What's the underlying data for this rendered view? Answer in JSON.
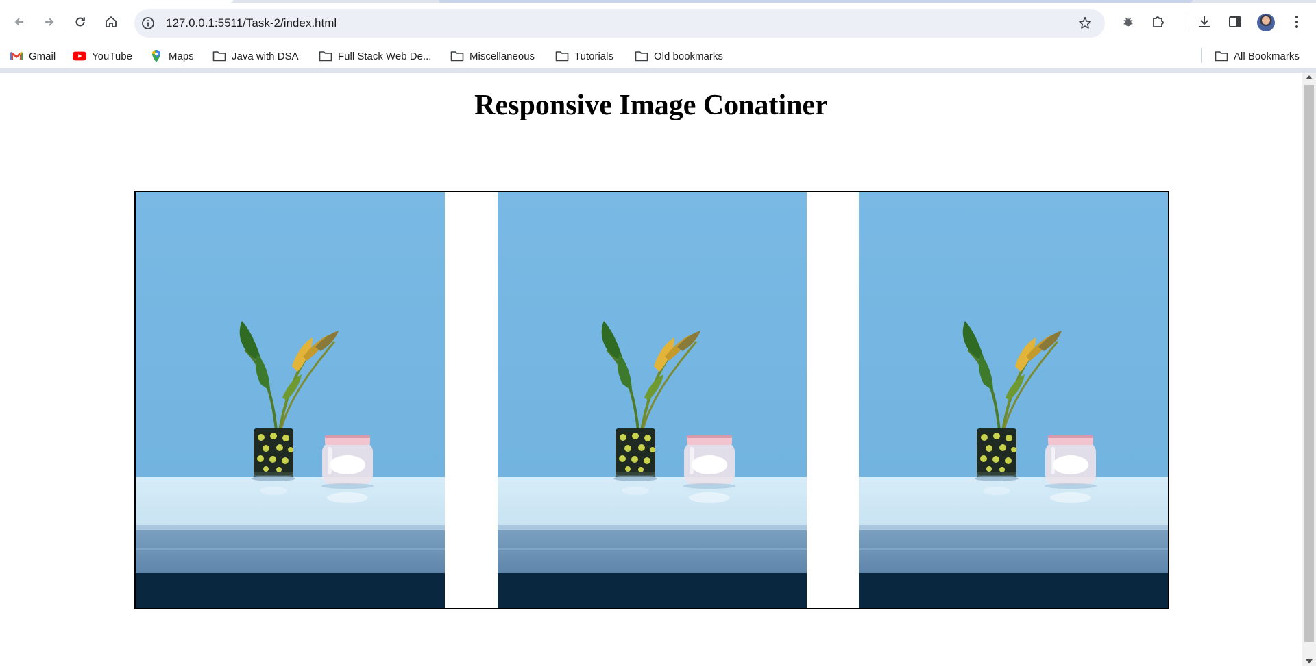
{
  "browser": {
    "url": "127.0.0.1:5511/Task-2/index.html",
    "bookmarks": [
      {
        "label": "Gmail",
        "icon": "gmail-icon"
      },
      {
        "label": "YouTube",
        "icon": "youtube-icon"
      },
      {
        "label": "Maps",
        "icon": "maps-icon"
      },
      {
        "label": "Java with DSA",
        "icon": "folder-icon"
      },
      {
        "label": "Full Stack Web De...",
        "icon": "folder-icon"
      },
      {
        "label": "Miscellaneous",
        "icon": "folder-icon"
      },
      {
        "label": "Tutorials",
        "icon": "folder-icon"
      },
      {
        "label": "Old bookmarks",
        "icon": "folder-icon"
      }
    ],
    "all_bookmarks": "All Bookmarks"
  },
  "page": {
    "title": "Responsive Image Conatiner",
    "images": [
      {
        "alt": "plant-vase-on-shelf"
      },
      {
        "alt": "plant-vase-on-shelf"
      },
      {
        "alt": "plant-vase-on-shelf"
      }
    ]
  },
  "colors": {
    "wall": "#72b3e0",
    "shelf": "#c9e3f2",
    "shadow": "#0a2740",
    "accent": "#0b57d0"
  }
}
